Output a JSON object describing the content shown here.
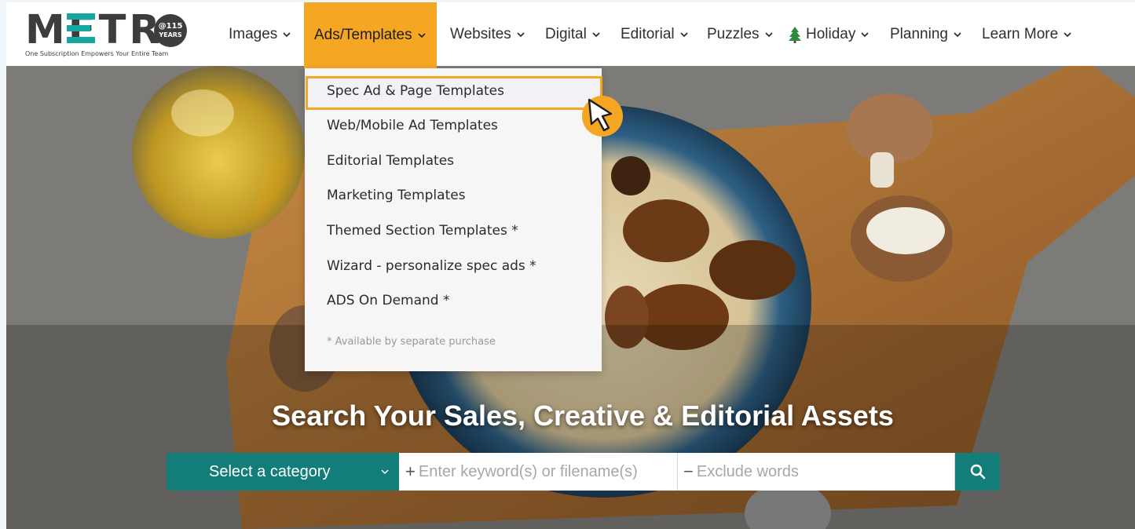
{
  "brand": {
    "logo_text": "METR",
    "logo_o_line1": "@115",
    "logo_o_line2": "YEARS",
    "tagline": "One Subscription Empowers Your Entire Team",
    "accent": "#f5a623",
    "teal": "#137d7a"
  },
  "nav": {
    "items": [
      {
        "label": "Images"
      },
      {
        "label": "Ads/Templates"
      },
      {
        "label": "Websites"
      },
      {
        "label": "Digital"
      },
      {
        "label": "Editorial"
      },
      {
        "label": "Puzzles"
      },
      {
        "label": "Holiday"
      },
      {
        "label": "Planning"
      },
      {
        "label": "Learn More"
      }
    ],
    "active": "Ads/Templates"
  },
  "dropdown": {
    "items": [
      {
        "label": "Spec Ad & Page Templates"
      },
      {
        "label": "Web/Mobile Ad Templates"
      },
      {
        "label": "Editorial Templates"
      },
      {
        "label": "Marketing Templates"
      },
      {
        "label": "Themed Section Templates *"
      },
      {
        "label": "Wizard - personalize spec ads *"
      },
      {
        "label": "ADS On Demand *"
      }
    ],
    "note": "* Available by separate purchase",
    "highlighted": "Spec Ad & Page Templates"
  },
  "hero": {
    "title": "Search Your Sales, Creative & Editorial Assets"
  },
  "search": {
    "category_label": "Select a category",
    "keyword_placeholder": "Enter keyword(s) or filename(s)",
    "exclude_placeholder": "Exclude words"
  },
  "icons": {
    "nav_chevron": "chevron-down-icon",
    "holiday": "tree-icon",
    "search": "search-icon",
    "cursor": "pointer-cursor-icon"
  }
}
